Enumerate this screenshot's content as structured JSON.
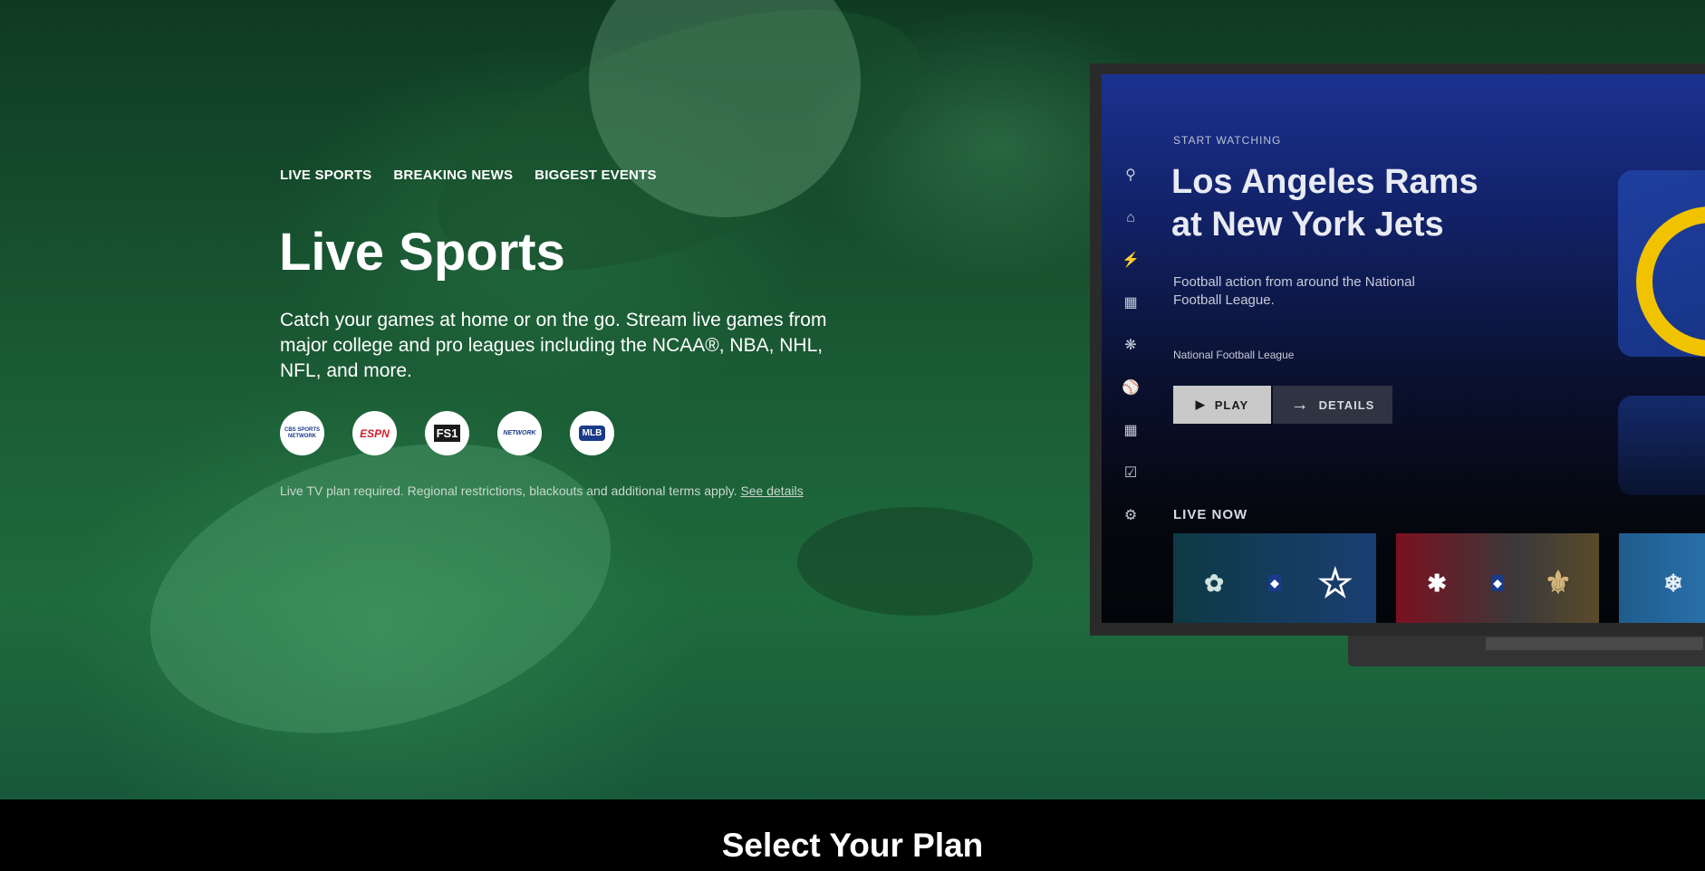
{
  "nav": {
    "items": [
      "LIVE SPORTS",
      "BREAKING NEWS",
      "BIGGEST EVENTS"
    ]
  },
  "hero": {
    "title": "Live Sports",
    "description": "Catch your games at home or on the go. Stream live games from major college and pro leagues including the NCAA®, NBA, NHL, NFL, and more.",
    "logos": [
      {
        "name": "cbs-sports-network-logo",
        "label": "CBS SPORTS NETWORK",
        "color": "#1a3a8a"
      },
      {
        "name": "espn-logo",
        "label": "ESPN",
        "color": "#d21f2b"
      },
      {
        "name": "fs1-logo",
        "label": "FS1",
        "color": "#1a1a1a"
      },
      {
        "name": "nfl-network-logo",
        "label": "NETWORK",
        "color": "#1a3a8a"
      },
      {
        "name": "mlb-network-logo",
        "label": "MLB",
        "color": "#1a3a8a"
      }
    ],
    "disclaimer": "Live TV plan required. Regional restrictions, blackouts and additional terms apply.",
    "disclaimer_link": "See details"
  },
  "tv": {
    "start_label": "START WATCHING",
    "title": "Los Angeles Rams at New York Jets",
    "description": "Football action from around the National Football League.",
    "league": "National Football League",
    "play_label": "PLAY",
    "details_label": "DETAILS",
    "live_now_label": "LIVE NOW",
    "rail_icons": [
      "search-icon",
      "home-icon",
      "lightning-icon",
      "tv-icon",
      "movie-reel-icon",
      "sports-icon",
      "grid-icon",
      "checklist-icon",
      "gear-icon"
    ]
  },
  "footer": {
    "heading": "Select Your Plan"
  },
  "colors": {
    "hero_green": "#1e6b3d",
    "tv_blue": "#1b3290",
    "footer_bg": "#000000"
  }
}
